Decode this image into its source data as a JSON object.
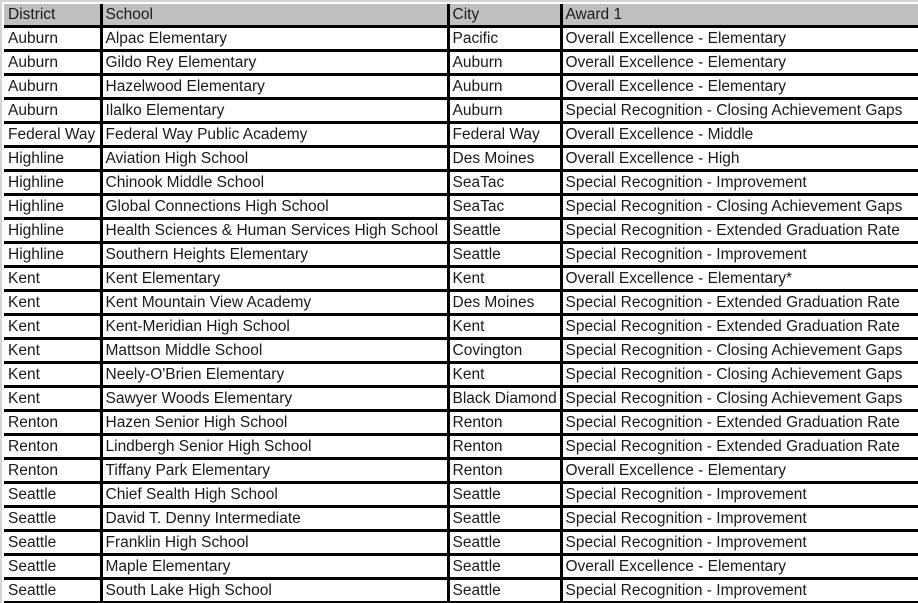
{
  "table": {
    "columns": [
      "District",
      "School",
      "City",
      "Award 1"
    ],
    "rows": [
      [
        "Auburn",
        "Alpac Elementary",
        "Pacific",
        "Overall Excellence - Elementary"
      ],
      [
        "Auburn",
        "Gildo Rey Elementary",
        "Auburn",
        "Overall Excellence - Elementary"
      ],
      [
        "Auburn",
        "Hazelwood Elementary",
        "Auburn",
        "Overall Excellence - Elementary"
      ],
      [
        "Auburn",
        "Ilalko Elementary",
        "Auburn",
        "Special Recognition - Closing Achievement Gaps"
      ],
      [
        "Federal Way",
        "Federal Way Public Academy",
        "Federal Way",
        "Overall Excellence - Middle"
      ],
      [
        "Highline",
        "Aviation High School",
        "Des Moines",
        "Overall Excellence - High"
      ],
      [
        "Highline",
        "Chinook Middle School",
        "SeaTac",
        "Special Recognition - Improvement"
      ],
      [
        "Highline",
        "Global Connections High School",
        "SeaTac",
        "Special Recognition - Closing Achievement Gaps"
      ],
      [
        "Highline",
        "Health Sciences & Human Services High School",
        "Seattle",
        "Special Recognition - Extended Graduation Rate"
      ],
      [
        "Highline",
        "Southern Heights Elementary",
        "Seattle",
        "Special Recognition - Improvement"
      ],
      [
        "Kent",
        "Kent Elementary",
        "Kent",
        "Overall Excellence - Elementary*"
      ],
      [
        "Kent",
        "Kent Mountain View Academy",
        "Des Moines",
        "Special Recognition - Extended Graduation Rate"
      ],
      [
        "Kent",
        "Kent-Meridian High School",
        "Kent",
        "Special Recognition - Extended Graduation Rate"
      ],
      [
        "Kent",
        "Mattson Middle School",
        "Covington",
        "Special Recognition - Closing Achievement Gaps"
      ],
      [
        "Kent",
        "Neely-O'Brien Elementary",
        "Kent",
        "Special Recognition - Closing Achievement Gaps"
      ],
      [
        "Kent",
        "Sawyer Woods Elementary",
        "Black Diamond",
        "Special Recognition - Closing Achievement Gaps"
      ],
      [
        "Renton",
        "Hazen Senior High School",
        "Renton",
        "Special Recognition - Extended Graduation Rate"
      ],
      [
        "Renton",
        "Lindbergh Senior High School",
        "Renton",
        "Special Recognition - Extended Graduation Rate"
      ],
      [
        "Renton",
        "Tiffany Park Elementary",
        "Renton",
        "Overall Excellence - Elementary"
      ],
      [
        "Seattle",
        "Chief Sealth High School",
        "Seattle",
        "Special Recognition - Improvement"
      ],
      [
        "Seattle",
        "David T. Denny Intermediate",
        "Seattle",
        "Special Recognition - Improvement"
      ],
      [
        "Seattle",
        "Franklin High School",
        "Seattle",
        "Special Recognition - Improvement"
      ],
      [
        "Seattle",
        "Maple Elementary",
        "Seattle",
        "Overall Excellence - Elementary"
      ],
      [
        "Seattle",
        "South Lake High School",
        "Seattle",
        "Special Recognition - Improvement"
      ]
    ]
  },
  "colors": {
    "header_background": "#c0c0c0",
    "grid_lines": "#000000"
  }
}
